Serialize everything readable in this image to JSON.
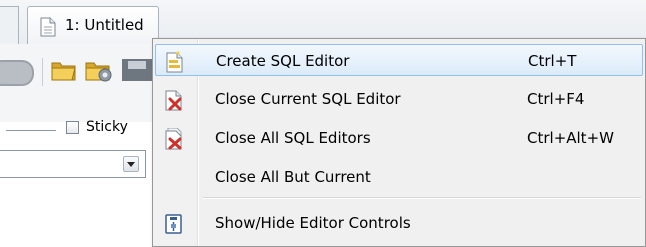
{
  "editor_tab": {
    "label": "1: Untitled",
    "icon": "document-icon"
  },
  "toolbar": {
    "buttons": [
      {
        "icon": "stop-icon"
      },
      {
        "icon": "folder-icon"
      },
      {
        "icon": "folder-gear-icon"
      },
      {
        "icon": "save-icon"
      }
    ]
  },
  "sticky": {
    "label": "Sticky",
    "checked": false
  },
  "combo": {
    "value": ""
  },
  "context_menu": {
    "items": [
      {
        "label": "Create SQL Editor",
        "shortcut": "Ctrl+T",
        "icon": "new-document-icon",
        "highlighted": true
      },
      {
        "label": "Close Current SQL Editor",
        "shortcut": "Ctrl+F4",
        "icon": "close-document-icon",
        "highlighted": false
      },
      {
        "label": "Close All SQL Editors",
        "shortcut": "Ctrl+Alt+W",
        "icon": "close-all-documents-icon",
        "highlighted": false
      },
      {
        "label": "Close All But Current",
        "shortcut": "",
        "icon": "",
        "highlighted": false
      },
      {
        "label": "Show/Hide Editor Controls",
        "shortcut": "",
        "icon": "editor-controls-icon",
        "highlighted": false
      }
    ]
  },
  "colors": {
    "highlight_border": "#90c0f0",
    "highlight_fill": "#dcebfa",
    "close_red": "#d0302a",
    "folder_yellow": "#e8b93a"
  }
}
